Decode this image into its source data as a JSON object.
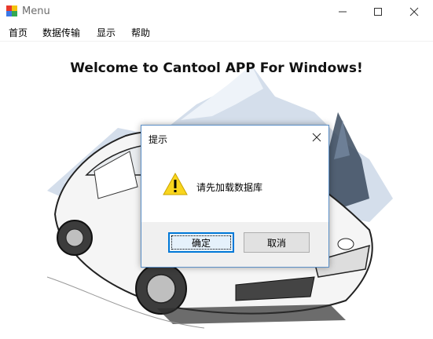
{
  "window": {
    "title": "Menu"
  },
  "menubar": {
    "items": [
      "首页",
      "数据传输",
      "显示",
      "帮助"
    ]
  },
  "content": {
    "headline": "Welcome to Cantool APP For Windows!"
  },
  "dialog": {
    "title": "提示",
    "message": "请先加载数据库",
    "ok_label": "确定",
    "cancel_label": "取消"
  },
  "colors": {
    "dialog_border": "#5b8fc7",
    "focus_border": "#0078d7",
    "warning": "#f9d51d"
  },
  "icons": [
    "app-icon",
    "minimize-icon",
    "maximize-icon",
    "close-icon",
    "warning-icon",
    "dialog-close-icon"
  ]
}
